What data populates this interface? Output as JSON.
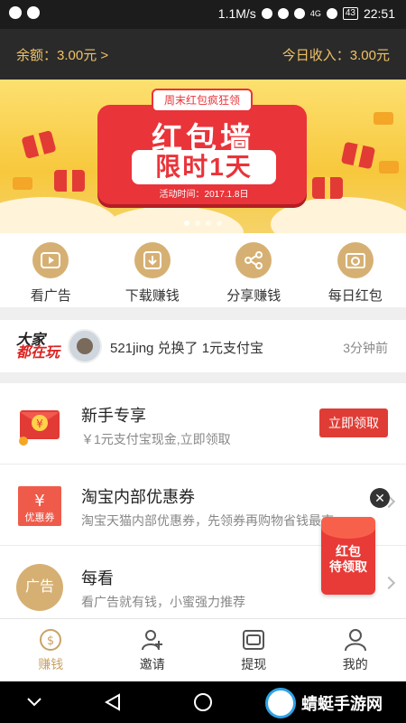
{
  "status_bar": {
    "net_speed": "1.1M/s",
    "signal": "4G",
    "battery": "43",
    "time": "22:51"
  },
  "top": {
    "balance": "余额：3.00元 >",
    "today_income": "今日收入：3.00元"
  },
  "banner": {
    "ribbon": "周末红包疯狂领",
    "title_line1": "红包墙",
    "title_line2": "限时1天",
    "date": "活动时间：2017.1.8日",
    "page_count": 4,
    "active_page": 1
  },
  "quick_nav": [
    {
      "label": "看广告",
      "icon": "play-icon"
    },
    {
      "label": "下载赚钱",
      "icon": "download-icon"
    },
    {
      "label": "分享赚钱",
      "icon": "share-icon"
    },
    {
      "label": "每日红包",
      "icon": "red-packet-icon"
    }
  ],
  "ticker": {
    "logo_line1": "大家",
    "logo_line2": "都在玩",
    "text": "521jing 兑换了 1元支付宝",
    "time": "3分钟前"
  },
  "tasks": [
    {
      "title": "新手专享",
      "desc": "￥1元支付宝现金,立即领取",
      "action": "立即领取",
      "icon": "red-envelope-icon"
    },
    {
      "title": "淘宝内部优惠券",
      "desc": "淘宝天猫内部优惠券，先领券再购物省钱最爽",
      "icon": "coupon-icon",
      "icon_text": "优惠券"
    },
    {
      "title": "每看",
      "desc": "看广告就有钱，小蜜强力推荐",
      "icon": "ad-icon",
      "icon_text": "广告"
    }
  ],
  "floating_packet": {
    "label_line1": "红包",
    "label_line2": "待领取",
    "close": "✕"
  },
  "tabs": [
    {
      "label": "赚钱",
      "icon": "money-icon",
      "active": true
    },
    {
      "label": "邀请",
      "icon": "add-user-icon",
      "active": false
    },
    {
      "label": "提现",
      "icon": "wallet-icon",
      "active": false
    },
    {
      "label": "我的",
      "icon": "profile-icon",
      "active": false
    }
  ],
  "watermark": "蜻蜓手游网",
  "colors": {
    "gold": "#c9a266",
    "red": "#e03c36",
    "dark_header": "#2a2a2a"
  }
}
